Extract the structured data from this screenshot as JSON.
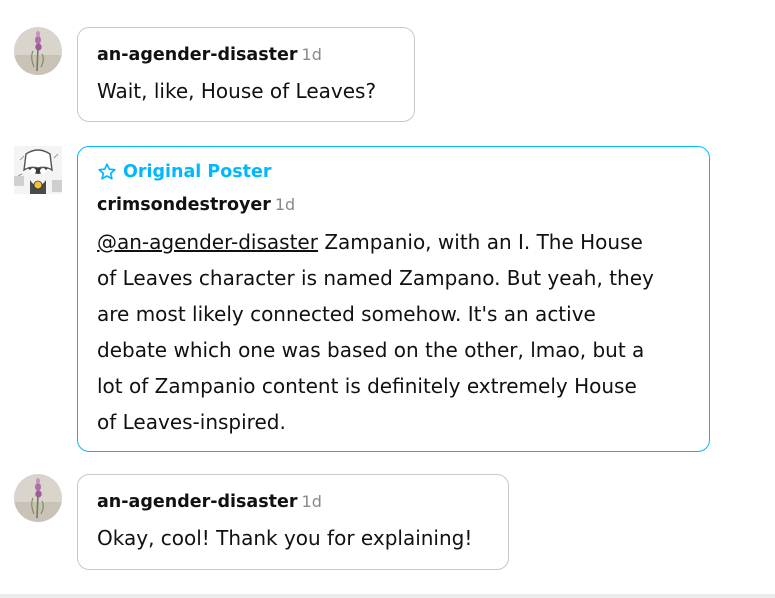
{
  "replies": [
    {
      "username": "an-agender-disaster",
      "time": "1d",
      "message": "Wait, like, House of Leaves?"
    },
    {
      "badge": "Original Poster",
      "badge_icon": "star-outline-icon",
      "username": "crimsondestroyer",
      "time": "1d",
      "mention": "@an-agender-disaster",
      "lines": [
        " Zampanio, with an I. The House",
        "of Leaves character is named Zampano. But yeah, they",
        "are most likely connected somehow. It's an active",
        "debate which one was based on the other, lmao, but a",
        "lot of Zampanio content is definitely extremely House",
        "of Leaves-inspired."
      ]
    },
    {
      "username": "an-agender-disaster",
      "time": "1d",
      "message": "Okay, cool! Thank you for explaining!"
    }
  ],
  "colors": {
    "op_accent": "#00b8ff",
    "bubble_border": "#c8c8c8",
    "timestamp": "#8a8a8a"
  }
}
